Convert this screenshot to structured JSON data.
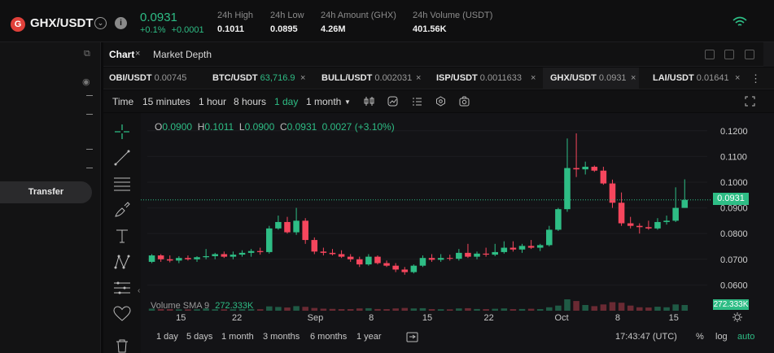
{
  "header": {
    "pair_logo": "G",
    "pair": "GHX/USDT",
    "last_price": "0.0931",
    "change_pct": "+0.1%",
    "change_abs": "+0.0001",
    "stats": [
      {
        "label": "24h High",
        "value": "0.1011"
      },
      {
        "label": "24h Low",
        "value": "0.0895"
      },
      {
        "label": "24h Amount (GHX)",
        "value": "4.26M"
      },
      {
        "label": "24h Volume (USDT)",
        "value": "401.56K"
      }
    ],
    "connection_icon": "wifi-icon"
  },
  "left_panel": {
    "transfer_label": "Transfer"
  },
  "chart_tabs": [
    {
      "label": "Chart",
      "active": true
    },
    {
      "label": "Market Depth",
      "active": false
    }
  ],
  "pair_tabs": [
    {
      "symbol": "OBI/USDT",
      "price": "0.00745",
      "up": false
    },
    {
      "symbol": "BTC/USDT",
      "price": "63,716.9",
      "up": true
    },
    {
      "symbol": "BULL/USDT",
      "price": "0.002031",
      "up": false
    },
    {
      "symbol": "ISP/USDT",
      "price": "0.0011633",
      "up": false
    },
    {
      "symbol": "GHX/USDT",
      "price": "0.0931",
      "up": false,
      "active": true
    },
    {
      "symbol": "LAI/USDT",
      "price": "0.01641",
      "up": false
    }
  ],
  "toolbar": {
    "timeframes": [
      "Time",
      "15 minutes",
      "1 hour",
      "8 hours",
      "1 day",
      "1 month"
    ],
    "active_timeframe": "1 day"
  },
  "chart": {
    "ohlc": {
      "o": "0.0900",
      "h": "0.1011",
      "l": "0.0900",
      "c": "0.0931",
      "chg": "0.0027 (+3.10%)"
    },
    "volume_label": "Volume SMA 9",
    "volume_value": "272.333K",
    "volume_badge": "272.333K",
    "price_badge": "0.0931"
  },
  "chart_data": {
    "type": "candlestick",
    "y_ticks": [
      "0.1200",
      "0.1100",
      "0.1000",
      "0.0900",
      "0.0800",
      "0.0700",
      "0.0600"
    ],
    "ylim": [
      0.056,
      0.125
    ],
    "x_ticks": [
      "15",
      "22",
      "Sep",
      "8",
      "15",
      "22",
      "Oct",
      "8",
      "15"
    ],
    "last_price": 0.0931,
    "up_color": "#2ebd85",
    "down_color": "#f6465d",
    "candles": [
      [
        0.069,
        0.072,
        0.0685,
        0.0715
      ],
      [
        0.0715,
        0.072,
        0.069,
        0.07
      ],
      [
        0.07,
        0.0715,
        0.0688,
        0.0695
      ],
      [
        0.0695,
        0.0712,
        0.0685,
        0.0705
      ],
      [
        0.0705,
        0.0715,
        0.0695,
        0.07
      ],
      [
        0.07,
        0.0712,
        0.069,
        0.0708
      ],
      [
        0.0708,
        0.074,
        0.07,
        0.0712
      ],
      [
        0.0712,
        0.0725,
        0.07,
        0.072
      ],
      [
        0.072,
        0.073,
        0.0705,
        0.071
      ],
      [
        0.071,
        0.073,
        0.07,
        0.0718
      ],
      [
        0.0718,
        0.0735,
        0.071,
        0.0725
      ],
      [
        0.0725,
        0.074,
        0.071,
        0.0732
      ],
      [
        0.0732,
        0.0745,
        0.0718,
        0.0728
      ],
      [
        0.0728,
        0.083,
        0.0722,
        0.082
      ],
      [
        0.082,
        0.087,
        0.0815,
        0.0845
      ],
      [
        0.0845,
        0.0865,
        0.08,
        0.0805
      ],
      [
        0.0805,
        0.09,
        0.0795,
        0.085
      ],
      [
        0.085,
        0.086,
        0.076,
        0.0775
      ],
      [
        0.0775,
        0.0785,
        0.072,
        0.073
      ],
      [
        0.073,
        0.0745,
        0.0715,
        0.0725
      ],
      [
        0.0725,
        0.074,
        0.0715,
        0.072
      ],
      [
        0.072,
        0.0735,
        0.0705,
        0.071
      ],
      [
        0.071,
        0.072,
        0.069,
        0.07
      ],
      [
        0.07,
        0.071,
        0.067,
        0.068
      ],
      [
        0.068,
        0.072,
        0.0675,
        0.071
      ],
      [
        0.071,
        0.0715,
        0.068,
        0.0685
      ],
      [
        0.0685,
        0.0695,
        0.067,
        0.0675
      ],
      [
        0.0675,
        0.0685,
        0.065,
        0.066
      ],
      [
        0.066,
        0.067,
        0.064,
        0.065
      ],
      [
        0.065,
        0.068,
        0.0645,
        0.0675
      ],
      [
        0.0675,
        0.0715,
        0.067,
        0.0705
      ],
      [
        0.0705,
        0.072,
        0.069,
        0.0698
      ],
      [
        0.0698,
        0.072,
        0.069,
        0.0705
      ],
      [
        0.0705,
        0.0718,
        0.0695,
        0.0702
      ],
      [
        0.0702,
        0.074,
        0.0695,
        0.0725
      ],
      [
        0.0725,
        0.076,
        0.0705,
        0.071
      ],
      [
        0.071,
        0.073,
        0.07,
        0.0722
      ],
      [
        0.0722,
        0.0745,
        0.071,
        0.0718
      ],
      [
        0.0718,
        0.076,
        0.0712,
        0.0728
      ],
      [
        0.0728,
        0.077,
        0.0722,
        0.0745
      ],
      [
        0.0745,
        0.077,
        0.073,
        0.0738
      ],
      [
        0.0738,
        0.076,
        0.0725,
        0.0752
      ],
      [
        0.0752,
        0.0775,
        0.074,
        0.0745
      ],
      [
        0.0745,
        0.076,
        0.0732,
        0.0755
      ],
      [
        0.0755,
        0.083,
        0.075,
        0.0815
      ],
      [
        0.0815,
        0.09,
        0.081,
        0.0895
      ],
      [
        0.0895,
        0.117,
        0.0885,
        0.1055
      ],
      [
        0.1055,
        0.119,
        0.102,
        0.105
      ],
      [
        0.105,
        0.108,
        0.103,
        0.106
      ],
      [
        0.106,
        0.1065,
        0.104,
        0.1045
      ],
      [
        0.1045,
        0.106,
        0.099,
        0.0995
      ],
      [
        0.0995,
        0.101,
        0.09,
        0.092
      ],
      [
        0.092,
        0.096,
        0.083,
        0.084
      ],
      [
        0.084,
        0.0865,
        0.082,
        0.083
      ],
      [
        0.083,
        0.084,
        0.08,
        0.0825
      ],
      [
        0.0825,
        0.085,
        0.0815,
        0.082
      ],
      [
        0.082,
        0.086,
        0.0815,
        0.0845
      ],
      [
        0.0845,
        0.087,
        0.0835,
        0.085
      ],
      [
        0.085,
        0.098,
        0.0845,
        0.09
      ],
      [
        0.09,
        0.1011,
        0.09,
        0.0931
      ]
    ],
    "volumes": [
      0.18,
      0.15,
      0.14,
      0.12,
      0.12,
      0.13,
      0.2,
      0.13,
      0.12,
      0.13,
      0.14,
      0.15,
      0.13,
      0.38,
      0.33,
      0.28,
      0.4,
      0.34,
      0.24,
      0.18,
      0.16,
      0.14,
      0.14,
      0.2,
      0.22,
      0.15,
      0.14,
      0.2,
      0.24,
      0.2,
      0.22,
      0.14,
      0.13,
      0.12,
      0.2,
      0.22,
      0.15,
      0.14,
      0.17,
      0.2,
      0.14,
      0.15,
      0.17,
      0.14,
      0.3,
      0.45,
      1.0,
      0.85,
      0.5,
      0.4,
      0.55,
      0.75,
      0.7,
      0.45,
      0.3,
      0.28,
      0.35,
      0.3,
      0.55,
      0.5
    ]
  },
  "bottom": {
    "ranges": [
      "1 day",
      "5 days",
      "1 month",
      "3 months",
      "6 months",
      "1 year"
    ],
    "clock": "17:43:47 (UTC)",
    "options": [
      "%",
      "log",
      "auto"
    ]
  }
}
